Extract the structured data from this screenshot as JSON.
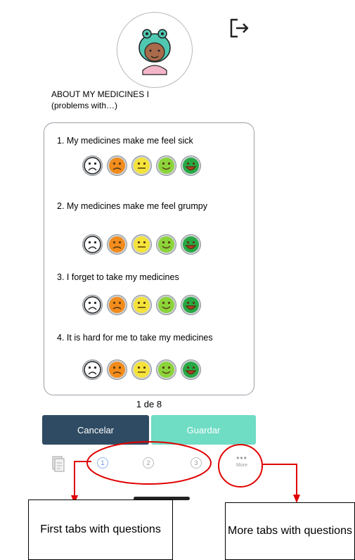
{
  "header": {
    "avatar_icon": "child-avatar-icon",
    "logout_icon": "logout-icon",
    "title_line1": "ABOUT MY MEDICINES I",
    "title_line2": "(problems with…)"
  },
  "questions": [
    {
      "text": "1. My medicines make me feel sick"
    },
    {
      "text": "2. My medicines make me feel grumpy"
    },
    {
      "text": "3. I forget to take my medicines"
    },
    {
      "text": "4. It is hard for me to take my medicines"
    }
  ],
  "rating_scale": [
    {
      "icon": "very-sad-face-icon",
      "color": "#ffffff"
    },
    {
      "icon": "sad-face-icon",
      "color": "#f28c1c"
    },
    {
      "icon": "neutral-face-icon",
      "color": "#f4e33a"
    },
    {
      "icon": "smile-face-icon",
      "color": "#8bd43a"
    },
    {
      "icon": "very-happy-face-icon",
      "color": "#27a845"
    }
  ],
  "pager": {
    "label": "1 de 8"
  },
  "actions": {
    "cancel_label": "Cancelar",
    "save_label": "Guardar"
  },
  "tabbar": {
    "doc_icon": "document-icon",
    "tabs": [
      "1",
      "2",
      "3"
    ],
    "more_label": "More"
  },
  "annotations": {
    "first_tabs": "First tabs with questions",
    "more_tabs": "More tabs with questions"
  },
  "colors": {
    "cancel_bg": "#2f4b63",
    "save_bg": "#6fdcc4",
    "annotation_red": "#e00000"
  }
}
